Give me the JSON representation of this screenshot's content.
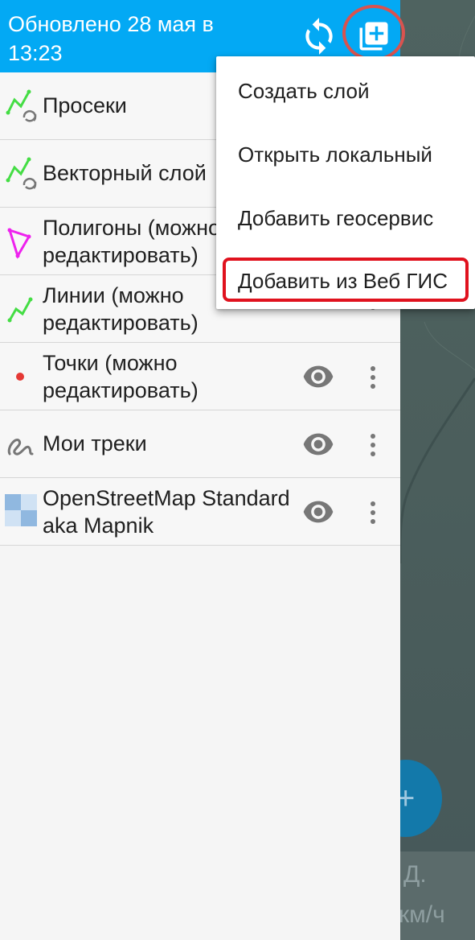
{
  "header": {
    "title": "Обновлено 28 мая в 13:23",
    "sync_icon": "sync-icon",
    "add_icon": "add-layer-icon",
    "color": "#03a9f4"
  },
  "layers": [
    {
      "label": "Просеки",
      "icon": "line-sync-icon",
      "icon_color": "#44dd44"
    },
    {
      "label": "Векторный слой",
      "icon": "line-sync-icon",
      "icon_color": "#44dd44"
    },
    {
      "label": "Полигоны (можно редактировать)",
      "icon": "polygon-icon",
      "icon_color": "#ee22ee"
    },
    {
      "label": "Линии (можно редактировать)",
      "icon": "polyline-icon",
      "icon_color": "#44dd44"
    },
    {
      "label": "Точки (можно редактировать)",
      "icon": "point-icon",
      "icon_color": "#e53935"
    },
    {
      "label": "Мои треки",
      "icon": "track-icon",
      "icon_color": "#777777"
    },
    {
      "label": "OpenStreetMap Standard aka Mapnik",
      "icon": "tile-icon",
      "icon_color": "#90b8e0"
    }
  ],
  "menu": {
    "items": [
      "Создать слой",
      "Открыть локальный",
      "Добавить геосервис",
      "Добавить из Веб ГИС"
    ]
  },
  "map": {
    "info_line1": "Д.",
    "info_line2": "км/ч",
    "fab_label": "+"
  }
}
